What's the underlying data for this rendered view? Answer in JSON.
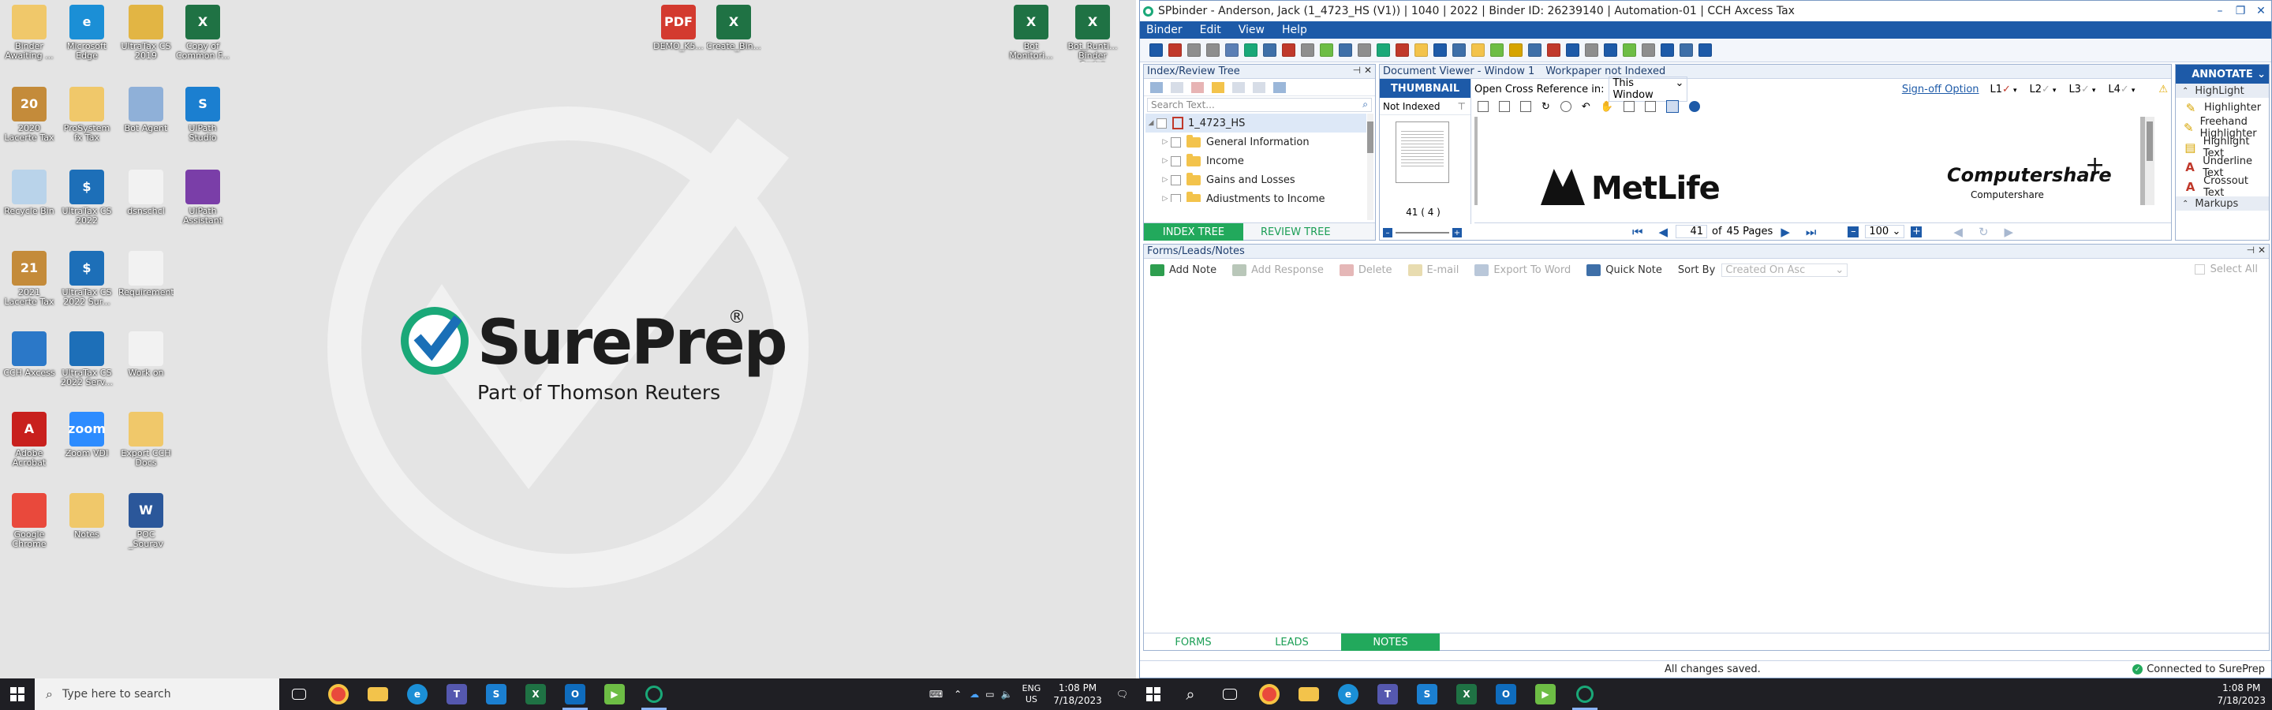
{
  "desktop": {
    "icons": [
      {
        "label": "Binder Awaiting ...",
        "glyph": "",
        "color": "#f0c86a"
      },
      {
        "label": "Microsoft Edge",
        "glyph": "e",
        "color": "#1b8fd6"
      },
      {
        "label": "UltraTax CS 2019",
        "glyph": "",
        "color": "#e2b544"
      },
      {
        "label": "Copy of Common F...",
        "glyph": "X",
        "color": "#1f7244"
      },
      {
        "label": "2020 Lacerte Tax",
        "glyph": "20",
        "color": "#c48b3a"
      },
      {
        "label": "ProSystem fx Tax",
        "glyph": "",
        "color": "#f0c86a"
      },
      {
        "label": "Bot Agent",
        "glyph": "",
        "color": "#8fb0d8"
      },
      {
        "label": "UiPath Studio",
        "glyph": "S",
        "color": "#1b7fd0"
      },
      {
        "label": "Recycle Bin",
        "glyph": "",
        "color": "#b9d3ea"
      },
      {
        "label": "UltraTax CS 2022",
        "glyph": "$",
        "color": "#1d6fb8"
      },
      {
        "label": "dsnschcl",
        "glyph": "",
        "color": "#f2f2f2"
      },
      {
        "label": "UiPath Assistant",
        "glyph": "",
        "color": "#7a3ea8"
      },
      {
        "label": "2021 Lacerte Tax",
        "glyph": "21",
        "color": "#c48b3a"
      },
      {
        "label": "UltraTax CS 2022 Sur...",
        "glyph": "$",
        "color": "#1d6fb8"
      },
      {
        "label": "Requirement",
        "glyph": "",
        "color": "#f2f2f2"
      },
      {
        "label": "CCH Axcess",
        "glyph": "",
        "color": "#2b78c8"
      },
      {
        "label": "UltraTax CS 2022 Serv...",
        "glyph": "",
        "color": "#1d6fb8"
      },
      {
        "label": "Work on",
        "glyph": "",
        "color": "#f2f2f2"
      },
      {
        "label": "Adobe Acrobat",
        "glyph": "A",
        "color": "#c8201d"
      },
      {
        "label": "Zoom VDI",
        "glyph": "zoom",
        "color": "#2d8cff"
      },
      {
        "label": "Export CCH Docs",
        "glyph": "",
        "color": "#f0c86a"
      },
      {
        "label": "Google Chrome",
        "glyph": "",
        "color": "#e9493c"
      },
      {
        "label": "Notes",
        "glyph": "",
        "color": "#f0c86a"
      },
      {
        "label": "POC _Sourav",
        "glyph": "W",
        "color": "#2b579a"
      },
      {
        "label": "DEMO_K5...",
        "glyph": "PDF",
        "color": "#d33a2f"
      },
      {
        "label": "Create_Bin...",
        "glyph": "X",
        "color": "#1f7244"
      },
      {
        "label": "Bot Monitori...",
        "glyph": "X",
        "color": "#1f7244"
      },
      {
        "label": "Bot_Runti... Binder Script",
        "glyph": "X",
        "color": "#1f7244"
      }
    ],
    "brand": {
      "name": "SurePrep",
      "reg": "®",
      "subtitle": "Part of Thomson Reuters",
      "accent": "#1aa878",
      "blue": "#1a6fb7"
    }
  },
  "taskbar_left": {
    "search_placeholder": "Type here to search",
    "lang_top": "ENG",
    "lang_bottom": "US",
    "time": "1:08 PM",
    "date": "7/18/2023"
  },
  "taskbar_right": {
    "time": "1:08 PM",
    "date": "7/18/2023"
  },
  "app": {
    "title": "SPbinder - Anderson, Jack (1_4723_HS (V1)) | 1040 | 2022 | Binder ID: 26239140 | Automation-01 | CCH Axcess Tax",
    "menu": [
      "Binder",
      "Edit",
      "View",
      "Help"
    ],
    "index_pane": {
      "title": "Index/Review Tree",
      "search_placeholder": "Search Text...",
      "root": "1_4723_HS",
      "items": [
        "General Information",
        "Income",
        "Gains and Losses",
        "Adjustments to Income"
      ],
      "tab_index": "INDEX TREE",
      "tab_review": "REVIEW TREE"
    },
    "viewer": {
      "title": "Document Viewer - Window 1",
      "status": "Workpaper not Indexed",
      "thumbnail_tab": "THUMBNAIL",
      "cross_ref_label": "Open Cross Reference in:",
      "cross_ref_value": "This Window",
      "signoff": "Sign-off Option",
      "levels": [
        "L1",
        "L2",
        "L3",
        "L4"
      ],
      "filter_value": "Not Indexed",
      "thumb_caption": "41 ( 4 )",
      "doc_logo_left": "MetLife",
      "doc_logo_right": "Computershare",
      "doc_logo_right_small": "Computershare",
      "page_current": "41",
      "page_of": "of",
      "page_total": "45",
      "page_word": "Pages",
      "zoom": "100"
    },
    "annotate": {
      "title": "ANNOTATE",
      "section_highlight": "HighLight",
      "items": [
        {
          "label": "Highlighter",
          "glyph": "✎",
          "color": "#d6a400"
        },
        {
          "label": "Freehand Highlighter",
          "glyph": "✎",
          "color": "#d6a400"
        },
        {
          "label": "Highlight Text",
          "glyph": "▤",
          "color": "#d6a400"
        },
        {
          "label": "Underline Text",
          "glyph": "A",
          "color": "#c0392b"
        },
        {
          "label": "Crossout Text",
          "glyph": "A",
          "color": "#c0392b"
        }
      ],
      "section_markups": "Markups"
    },
    "forms_pane": {
      "title": "Forms/Leads/Notes",
      "buttons": [
        {
          "label": "Add Note",
          "enabled": true,
          "color": "#2e9e4f"
        },
        {
          "label": "Add Response",
          "enabled": false,
          "color": "#b9c7b9"
        },
        {
          "label": "Delete",
          "enabled": false,
          "color": "#e5b7b7"
        },
        {
          "label": "E-mail",
          "enabled": false,
          "color": "#e8dcb0"
        },
        {
          "label": "Export To Word",
          "enabled": false,
          "color": "#b9c7d9"
        },
        {
          "label": "Quick Note",
          "enabled": true,
          "color": "#3e6fa8"
        }
      ],
      "sort_label": "Sort By",
      "sort_value": "Created On Asc",
      "select_all": "Select All",
      "tabs": [
        "FORMS",
        "LEADS",
        "NOTES"
      ]
    },
    "status": {
      "message": "All changes saved.",
      "connection": "Connected to SurePrep"
    }
  }
}
